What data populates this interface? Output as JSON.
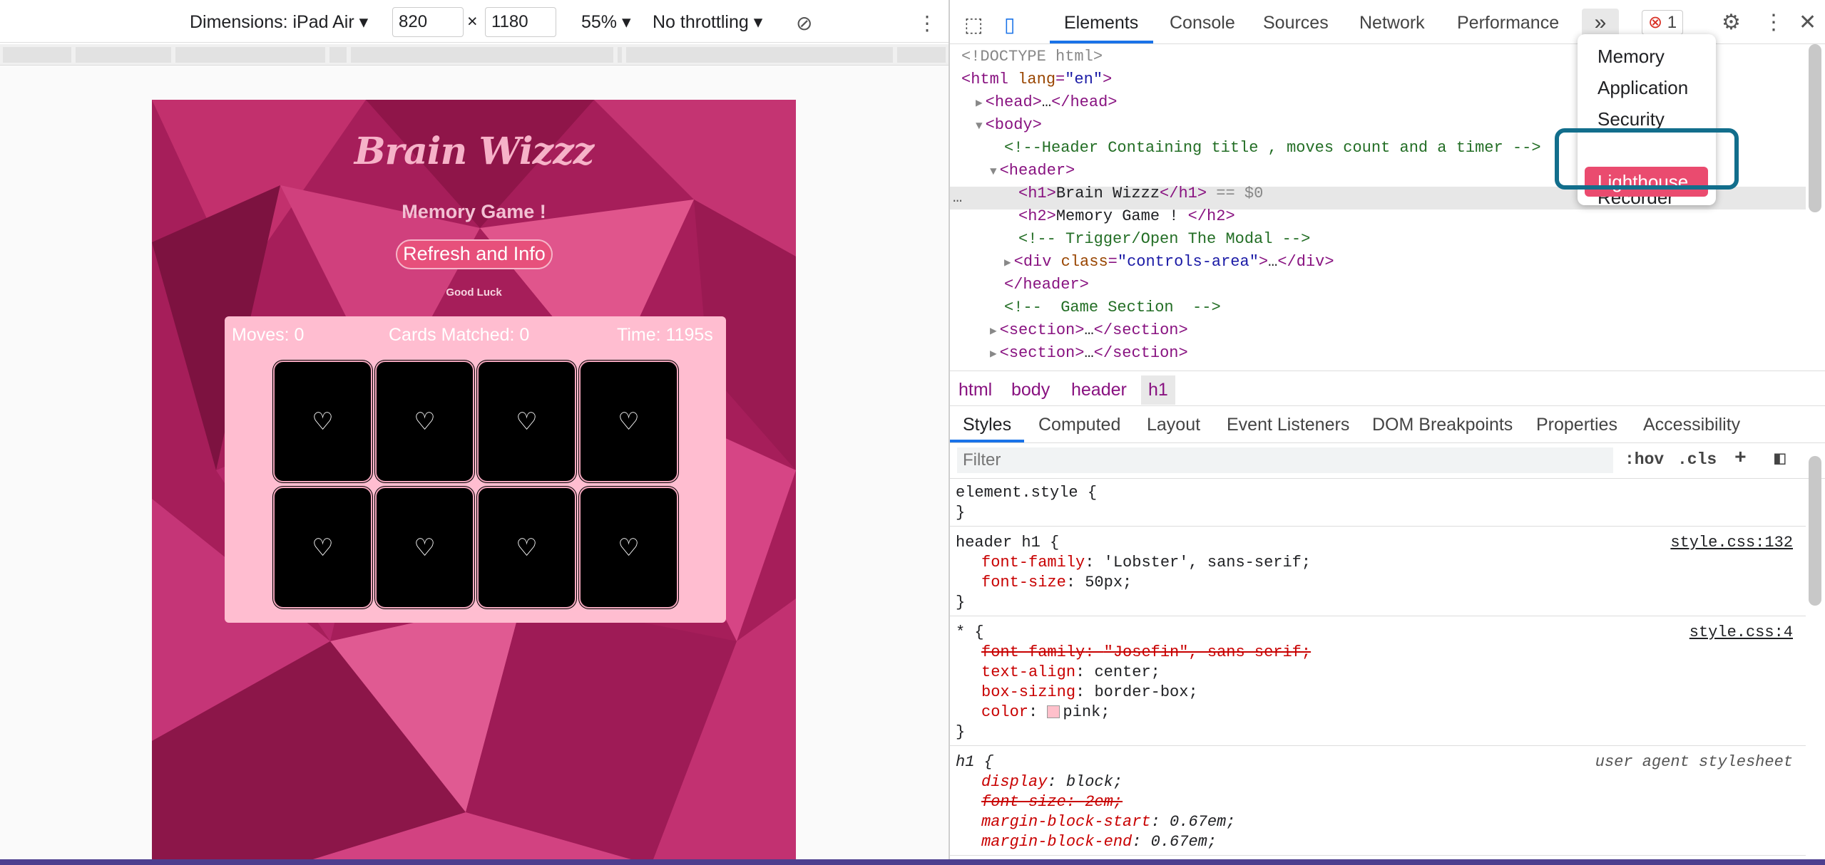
{
  "device_toolbar": {
    "dimensions_label": "Dimensions: iPad Air",
    "width": "820",
    "times": "×",
    "height": "1180",
    "zoom": "55%",
    "throttling": "No throttling"
  },
  "game": {
    "title": "Brain Wizzz",
    "subtitle": "Memory Game !",
    "refresh_button": "Refresh and Info",
    "good_luck": "Good Luck",
    "moves": "Moves: 0",
    "cards_matched": "Cards Matched: 0",
    "time": "Time: 1195s",
    "card_symbol": "♡",
    "card_count": 8,
    "colors": {
      "background": "#b0205f",
      "board": "#ffbdd0",
      "button": "#e7507b",
      "card": "#000000"
    }
  },
  "devtools": {
    "tabs": [
      "Elements",
      "Console",
      "Sources",
      "Network",
      "Performance"
    ],
    "more_tabs": "»",
    "error_count": "1",
    "overflow_menu": [
      "Memory",
      "Application",
      "Security",
      "Lighthouse",
      "Recorder"
    ],
    "overflow_selected": "Lighthouse",
    "dom_lines": [
      {
        "parts": [
          [
            "gray",
            "<!DOCTYPE html>"
          ]
        ]
      },
      {
        "parts": [
          [
            "tag",
            "<html "
          ],
          [
            "attr",
            "lang"
          ],
          [
            "tag",
            "="
          ],
          [
            "val",
            "\"en\""
          ],
          [
            "tag",
            ">"
          ]
        ]
      },
      {
        "parts": [
          [
            "gray",
            "▶"
          ],
          [
            "tag",
            "<head>"
          ],
          [
            "txt",
            "…"
          ],
          [
            "tag",
            "</head>"
          ]
        ]
      },
      {
        "parts": [
          [
            "gray",
            "▼"
          ],
          [
            "tag",
            "<body>"
          ]
        ]
      },
      {
        "parts": [
          [
            "cm",
            "<!--Header Containing title , moves count and a timer -->"
          ]
        ]
      },
      {
        "parts": [
          [
            "gray",
            "▼"
          ],
          [
            "tag",
            "<header>"
          ]
        ]
      },
      {
        "parts": [
          [
            "tag",
            "<h1>"
          ],
          [
            "txt",
            "Brain Wizzz"
          ],
          [
            "tag",
            "</h1>"
          ],
          [
            "gray",
            " == "
          ],
          [
            "gray",
            "$0"
          ]
        ]
      },
      {
        "parts": [
          [
            "tag",
            "<h2>"
          ],
          [
            "txt",
            "Memory Game ! "
          ],
          [
            "tag",
            "</h2>"
          ]
        ]
      },
      {
        "parts": [
          [
            "cm",
            "<!-- Trigger/Open The Modal -->"
          ]
        ]
      },
      {
        "parts": [
          [
            "gray",
            "▶"
          ],
          [
            "tag",
            "<div "
          ],
          [
            "attr",
            "class"
          ],
          [
            "tag",
            "="
          ],
          [
            "val",
            "\"controls-area\""
          ],
          [
            "tag",
            ">"
          ],
          [
            "txt",
            "…"
          ],
          [
            "tag",
            "</div>"
          ]
        ]
      },
      {
        "parts": [
          [
            "tag",
            "</header>"
          ]
        ]
      },
      {
        "parts": [
          [
            "cm",
            "<!--  Game Section  -->"
          ]
        ]
      },
      {
        "parts": [
          [
            "gray",
            "▶"
          ],
          [
            "tag",
            "<section>"
          ],
          [
            "txt",
            "…"
          ],
          [
            "tag",
            "</section>"
          ]
        ]
      },
      {
        "parts": [
          [
            "gray",
            "▶"
          ],
          [
            "tag",
            "<section>"
          ],
          [
            "txt",
            "…"
          ],
          [
            "tag",
            "</section>"
          ]
        ]
      }
    ],
    "dom_more": "…",
    "breadcrumbs": [
      "html",
      "body",
      "header",
      "h1"
    ],
    "sub_tabs": [
      "Styles",
      "Computed",
      "Layout",
      "Event Listeners",
      "DOM Breakpoints",
      "Properties",
      "Accessibility"
    ],
    "filter_placeholder": "Filter",
    "hov": ":hov",
    "cls": ".cls",
    "plus": "+",
    "rules": [
      {
        "selector": "element.style {",
        "source": "",
        "decls": [],
        "close": "}"
      },
      {
        "selector": "header h1 {",
        "source": "style.css:132",
        "decls": [
          [
            "font-family",
            "'Lobster', sans-serif;",
            false
          ],
          [
            "font-size",
            "50px;",
            false
          ]
        ],
        "close": "}"
      },
      {
        "selector": "* {",
        "source": "style.css:4",
        "decls": [
          [
            "font-family",
            "\"Josefin\", sans-serif;",
            true
          ],
          [
            "text-align",
            "center;",
            false
          ],
          [
            "box-sizing",
            "border-box;",
            false
          ],
          [
            "color",
            "pink;",
            false
          ]
        ],
        "close": "}"
      },
      {
        "selector": "h1 {",
        "source": "user agent stylesheet",
        "decls": [
          [
            "display",
            "block;",
            false
          ],
          [
            "font-size",
            "2em;",
            true
          ],
          [
            "margin-block-start",
            "0.67em;",
            false
          ],
          [
            "margin-block-end",
            "0.67em;",
            false
          ]
        ],
        "close": ""
      }
    ]
  }
}
